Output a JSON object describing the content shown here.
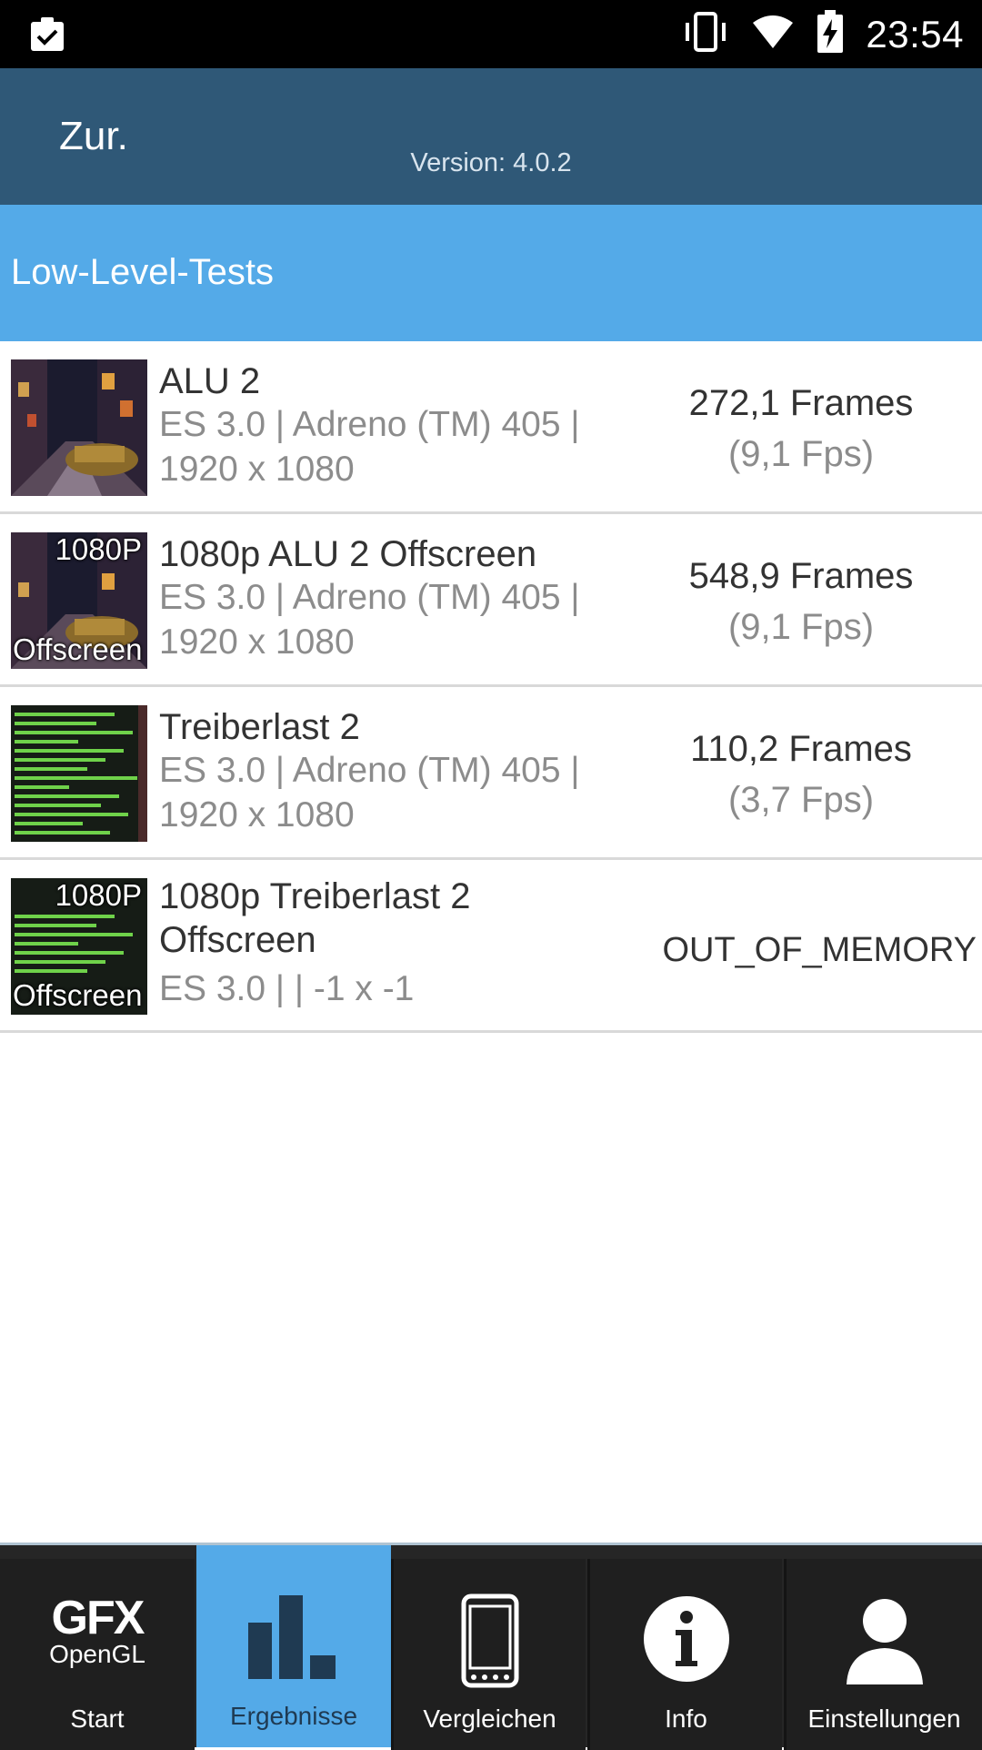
{
  "status_bar": {
    "time": "23:54",
    "icons": [
      "clipboard-check-icon",
      "vibrate-icon",
      "wifi-icon",
      "battery-charging-icon"
    ]
  },
  "header": {
    "back_label": "Zur.",
    "version": "Version: 4.0.2"
  },
  "section": {
    "title": "Low-Level-Tests"
  },
  "tests": [
    {
      "title": "ALU 2",
      "desc_line1": "ES 3.0 | Adreno (TM) 405 |",
      "desc_line2": "1920 x 1080",
      "frames": "272,1 Frames",
      "fps": "(9,1 Fps)",
      "thumb_labels": {
        "top": "",
        "bottom": ""
      }
    },
    {
      "title": "1080p ALU 2 Offscreen",
      "desc_line1": "ES 3.0 | Adreno (TM) 405 |",
      "desc_line2": "1920 x 1080",
      "frames": "548,9 Frames",
      "fps": "(9,1 Fps)",
      "thumb_labels": {
        "top": "1080P",
        "bottom": "Offscreen"
      }
    },
    {
      "title": "Treiberlast 2",
      "desc_line1": "ES 3.0 | Adreno (TM) 405 |",
      "desc_line2": "1920 x 1080",
      "frames": "110,2 Frames",
      "fps": "(3,7 Fps)",
      "thumb_labels": {
        "top": "",
        "bottom": ""
      }
    },
    {
      "title_line1": "1080p Treiberlast 2",
      "title_line2": "Offscreen",
      "desc_line1": "ES 3.0 |  | -1 x -1",
      "result": "OUT_OF_MEMORY",
      "thumb_labels": {
        "top": "1080P",
        "bottom": "Offscreen"
      }
    }
  ],
  "bottom_nav": {
    "start": {
      "label": "Start",
      "logo_main": "GFX",
      "logo_sub": "OpenGL"
    },
    "results": {
      "label": "Ergebnisse"
    },
    "compare": {
      "label": "Vergleichen"
    },
    "info": {
      "label": "Info"
    },
    "settings": {
      "label": "Einstellungen"
    }
  },
  "colors": {
    "header": "#2f5877",
    "section": "#54aae8",
    "nav_active": "#54aae8",
    "nav_bg": "#1f1f1f"
  }
}
